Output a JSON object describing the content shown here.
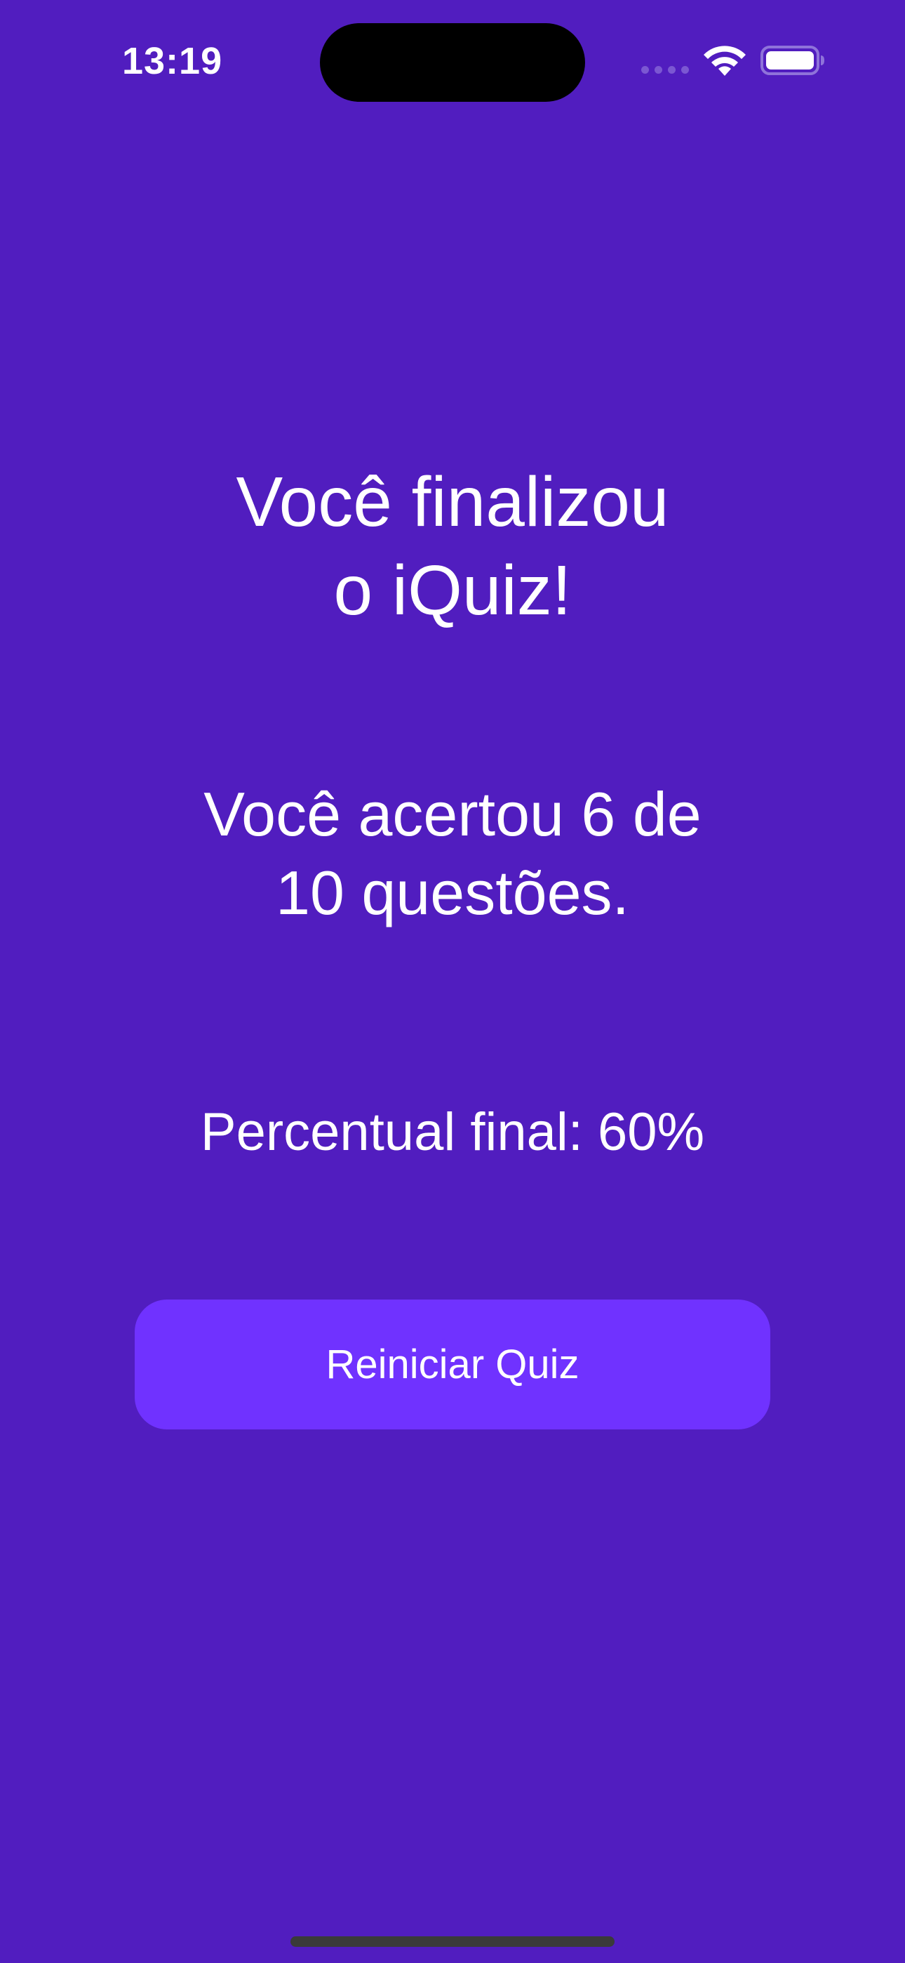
{
  "status_bar": {
    "time": "13:19",
    "icons": {
      "signal": "cellular-signal-icon",
      "wifi": "wifi-icon",
      "battery": "battery-icon"
    }
  },
  "result": {
    "title_line1": "Você finalizou",
    "title_line2": "o iQuiz!",
    "score_line1": "Você acertou 6 de",
    "score_line2": "10 questões.",
    "percentage": "Percentual final: 60%"
  },
  "actions": {
    "restart_label": "Reiniciar Quiz"
  },
  "colors": {
    "background": "#511DBF",
    "button": "#7032FF",
    "text": "#FFFFFF"
  }
}
